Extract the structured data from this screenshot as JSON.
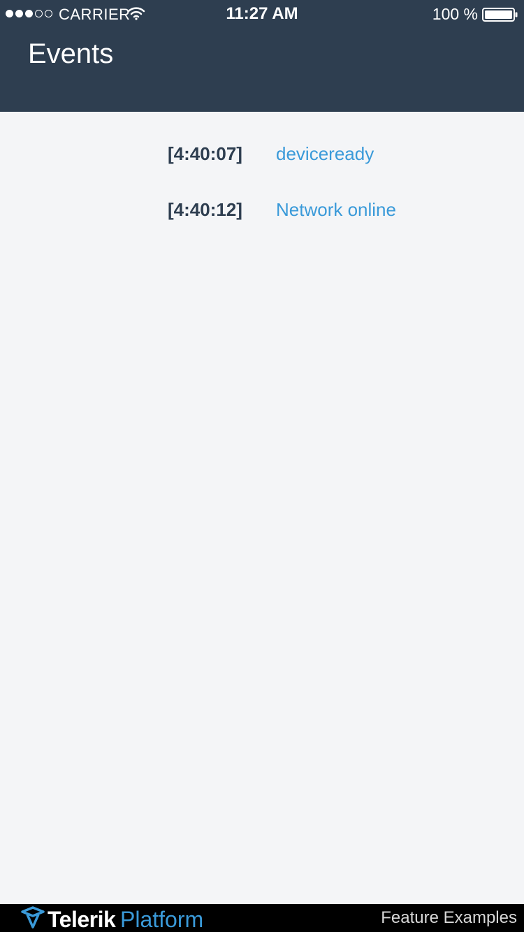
{
  "status_bar": {
    "carrier": "CARRIER",
    "time": "11:27 AM",
    "battery": "100 %",
    "signal_icon": "signal-dots-icon",
    "wifi_icon": "wifi-icon",
    "battery_icon": "battery-full-icon"
  },
  "header": {
    "title": "Events",
    "background": "#2e3e50"
  },
  "events": [
    {
      "time": "[4:40:07]",
      "name": "deviceready"
    },
    {
      "time": "[4:40:12]",
      "name": "Network online"
    }
  ],
  "footer": {
    "brand": "Telerik",
    "product": "Platform",
    "label": "Feature Examples",
    "logo_icon": "telerik-logo-icon"
  },
  "colors": {
    "accent": "#3a9ad9",
    "header": "#2e3e50",
    "background": "#f4f5f7"
  }
}
